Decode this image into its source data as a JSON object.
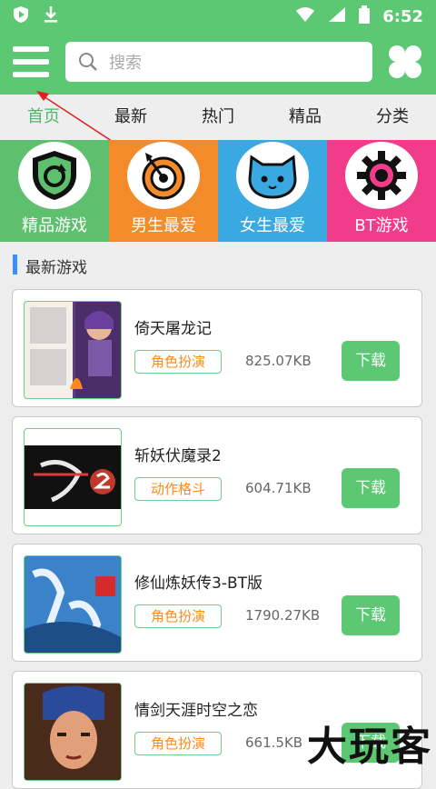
{
  "status": {
    "time": "6:52"
  },
  "search": {
    "placeholder": "搜索"
  },
  "tabs": [
    {
      "label": "首页",
      "active": true
    },
    {
      "label": "最新"
    },
    {
      "label": "热门"
    },
    {
      "label": "精品"
    },
    {
      "label": "分类"
    }
  ],
  "categories": [
    {
      "label": "精品游戏",
      "color": "#5ec06f",
      "icon": "shield-refresh-icon"
    },
    {
      "label": "男生最爱",
      "color": "#f38b2b",
      "icon": "target-arrow-icon"
    },
    {
      "label": "女生最爱",
      "color": "#3aa9e2",
      "icon": "cat-face-icon"
    },
    {
      "label": "BT游戏",
      "color": "#f03c8a",
      "icon": "gear-icon"
    }
  ],
  "section": {
    "title": "最新游戏"
  },
  "games": [
    {
      "name": "倚天屠龙记",
      "tag": "角色扮演",
      "size": "825.07KB",
      "download": "下载"
    },
    {
      "name": "斩妖伏魔录2",
      "tag": "动作格斗",
      "size": "604.71KB",
      "download": "下载"
    },
    {
      "name": "修仙炼妖传3-BT版",
      "tag": "角色扮演",
      "size": "1790.27KB",
      "download": "下载"
    },
    {
      "name": "情剑天涯时空之恋",
      "tag": "角色扮演",
      "size": "661.5KB",
      "download": "下载"
    }
  ],
  "watermark": "大玩客",
  "colors": {
    "header": "#5cc874",
    "active_tab": "#4cb86a",
    "tag_text": "#ff8a1b"
  }
}
